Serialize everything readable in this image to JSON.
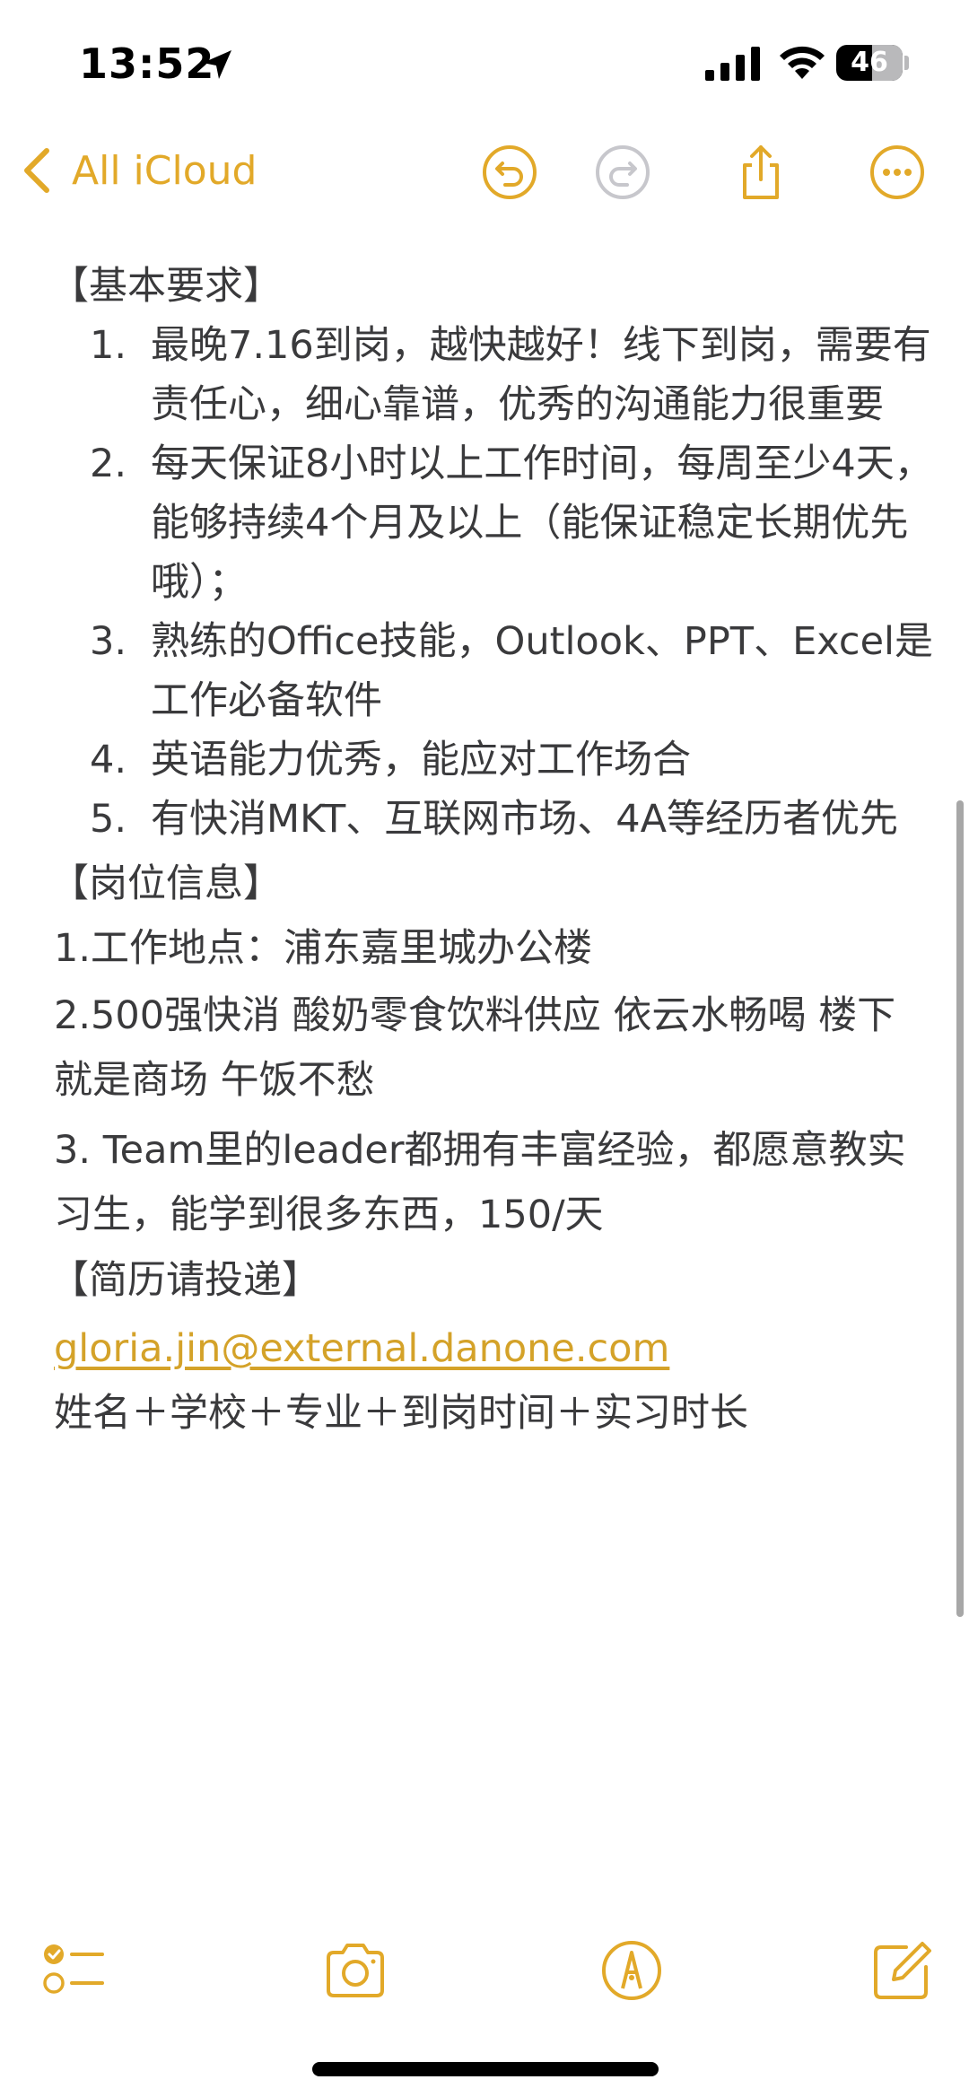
{
  "status_bar": {
    "time": "13:52",
    "battery": "46"
  },
  "nav": {
    "back_label": "All iCloud"
  },
  "note": {
    "section1_title": "【基本要求】",
    "requirements": [
      {
        "num": "1.",
        "text": "最晚7.16到岗，越快越好！线下到岗，需要有责任心，细心靠谱，优秀的沟通能力很重要"
      },
      {
        "num": "2.",
        "text": "每天保证8小时以上工作时间，每周至少4天，能够持续4个月及以上（能保证稳定长期优先哦）；"
      },
      {
        "num": "3.",
        "text": "熟练的Office技能，Outlook、PPT、Excel是工作必备软件"
      },
      {
        "num": "4.",
        "text": "英语能力优秀，能应对工作场合"
      },
      {
        "num": "5.",
        "text": "有快消MKT、互联网市场、4A等经历者优先"
      }
    ],
    "section2_title": "【岗位信息】",
    "info_1": "1.工作地点：浦东嘉里城办公楼",
    "info_2": "2.500强快消 酸奶零食饮料供应 依云水畅喝 楼下就是商场 午饭不愁",
    "info_3": "3. Team里的leader都拥有丰富经验，都愿意教实习生，能学到很多东西，150/天",
    "section3_title": "【简历请投递】",
    "email": "gloria.jin@external.danone.com",
    "format": "姓名＋学校＋专业＋到岗时间＋实习时长"
  },
  "colors": {
    "accent": "#e2a929",
    "text": "#3a3a3c"
  }
}
